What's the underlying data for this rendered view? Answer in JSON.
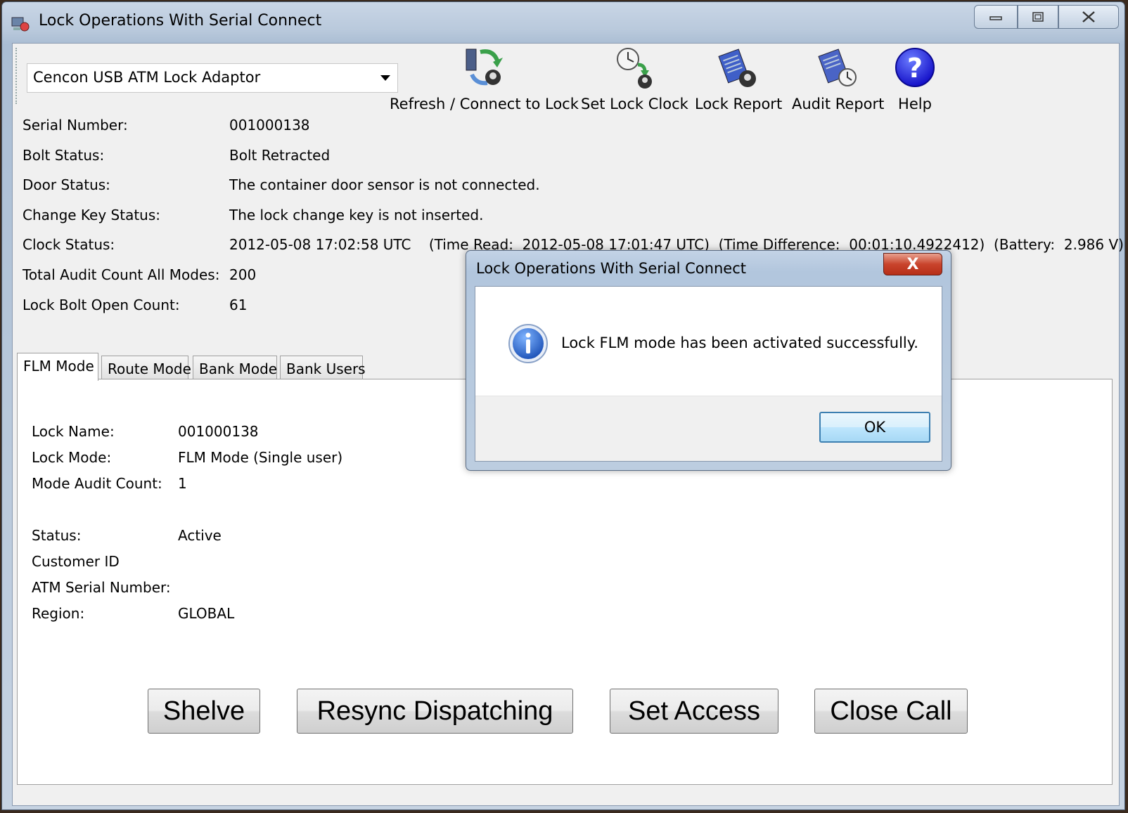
{
  "window": {
    "title": "Lock Operations With Serial Connect"
  },
  "toolbar": {
    "device_select": "Cencon USB ATM Lock Adaptor",
    "buttons": [
      {
        "label": "Refresh / Connect to Lock",
        "icon": "refresh-connect-icon"
      },
      {
        "label": "Set Lock Clock",
        "icon": "clock-icon"
      },
      {
        "label": "Lock Report",
        "icon": "lock-report-icon"
      },
      {
        "label": "Audit Report",
        "icon": "audit-report-icon"
      },
      {
        "label": "Help",
        "icon": "help-icon"
      }
    ]
  },
  "lock_info": {
    "serial_number_label": "Serial Number:",
    "serial_number": "001000138",
    "bolt_status_label": "Bolt Status:",
    "bolt_status": "Bolt Retracted",
    "door_status_label": "Door Status:",
    "door_status": "The container door sensor is not connected.",
    "change_key_label": "Change Key Status:",
    "change_key": "The lock change key is not inserted.",
    "clock_status_label": "Clock Status:",
    "clock_status": "2012-05-08 17:02:58 UTC    (Time Read:  2012-05-08 17:01:47 UTC)  (Time Difference:  00:01:10.4922412)  (Battery:  2.986 V)",
    "total_audit_label": "Total Audit Count All Modes:",
    "total_audit": "200",
    "bolt_open_label": "Lock Bolt Open Count:",
    "bolt_open": "61"
  },
  "tabs": {
    "items": [
      "FLM Mode",
      "Route Mode",
      "Bank Mode",
      "Bank Users"
    ],
    "active": "FLM Mode"
  },
  "flm": {
    "lock_name_label": "Lock Name:",
    "lock_name": "001000138",
    "lock_mode_label": "Lock Mode:",
    "lock_mode": "FLM Mode (Single user)",
    "mode_audit_label": "Mode Audit Count:",
    "mode_audit": "1",
    "status_label": "Status:",
    "status": "Active",
    "customer_id_label": "Customer ID",
    "customer_id": "",
    "atm_serial_label": "ATM Serial Number:",
    "atm_serial": "",
    "region_label": "Region:",
    "region": "GLOBAL",
    "buttons": {
      "shelve": "Shelve",
      "resync": "Resync Dispatching",
      "set_access": "Set Access",
      "close_call": "Close Call"
    }
  },
  "dialog": {
    "title": "Lock Operations With Serial Connect",
    "close_glyph": "X",
    "message": "Lock FLM mode has been activated successfully.",
    "ok_label": "OK"
  },
  "colors": {
    "accent": "#3c7fb1",
    "close_red": "#c9442c",
    "window_frame": "#b9c9dc"
  }
}
